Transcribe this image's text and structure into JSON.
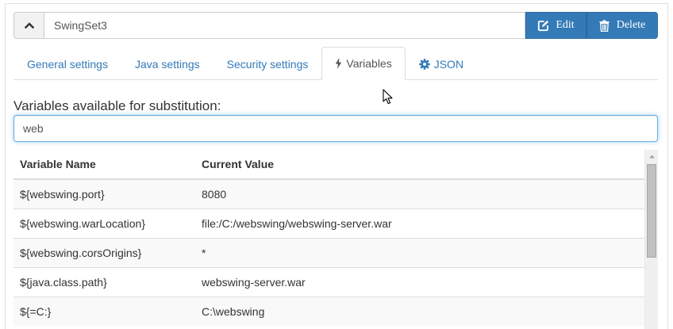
{
  "header": {
    "app_name": "SwingSet3",
    "collapse_icon": "chevron-up-icon",
    "edit_label": "Edit",
    "edit_icon": "edit-icon",
    "delete_label": "Delete",
    "delete_icon": "trash-icon"
  },
  "tabs": [
    {
      "label": "General settings",
      "active": false
    },
    {
      "label": "Java settings",
      "active": false
    },
    {
      "label": "Security settings",
      "active": false
    },
    {
      "label": "Variables",
      "active": true,
      "icon": "bolt-icon"
    },
    {
      "label": "JSON",
      "active": false,
      "icon": "gear-icon"
    }
  ],
  "variables": {
    "section_label": "Variables available for substitution:",
    "filter_value": "web",
    "columns": [
      "Variable Name",
      "Current Value"
    ],
    "rows": [
      {
        "name": "${webswing.port}",
        "value": "8080"
      },
      {
        "name": "${webswing.warLocation}",
        "value": "file:/C:/webswing/webswing-server.war"
      },
      {
        "name": "${webswing.corsOrigins}",
        "value": "*"
      },
      {
        "name": "${java.class.path}",
        "value": "webswing-server.war"
      },
      {
        "name": "${=C:}",
        "value": "C:\\webswing"
      }
    ]
  },
  "colors": {
    "primary": "#337ab7",
    "link": "#337ab7",
    "focus_border": "#66afe9"
  }
}
